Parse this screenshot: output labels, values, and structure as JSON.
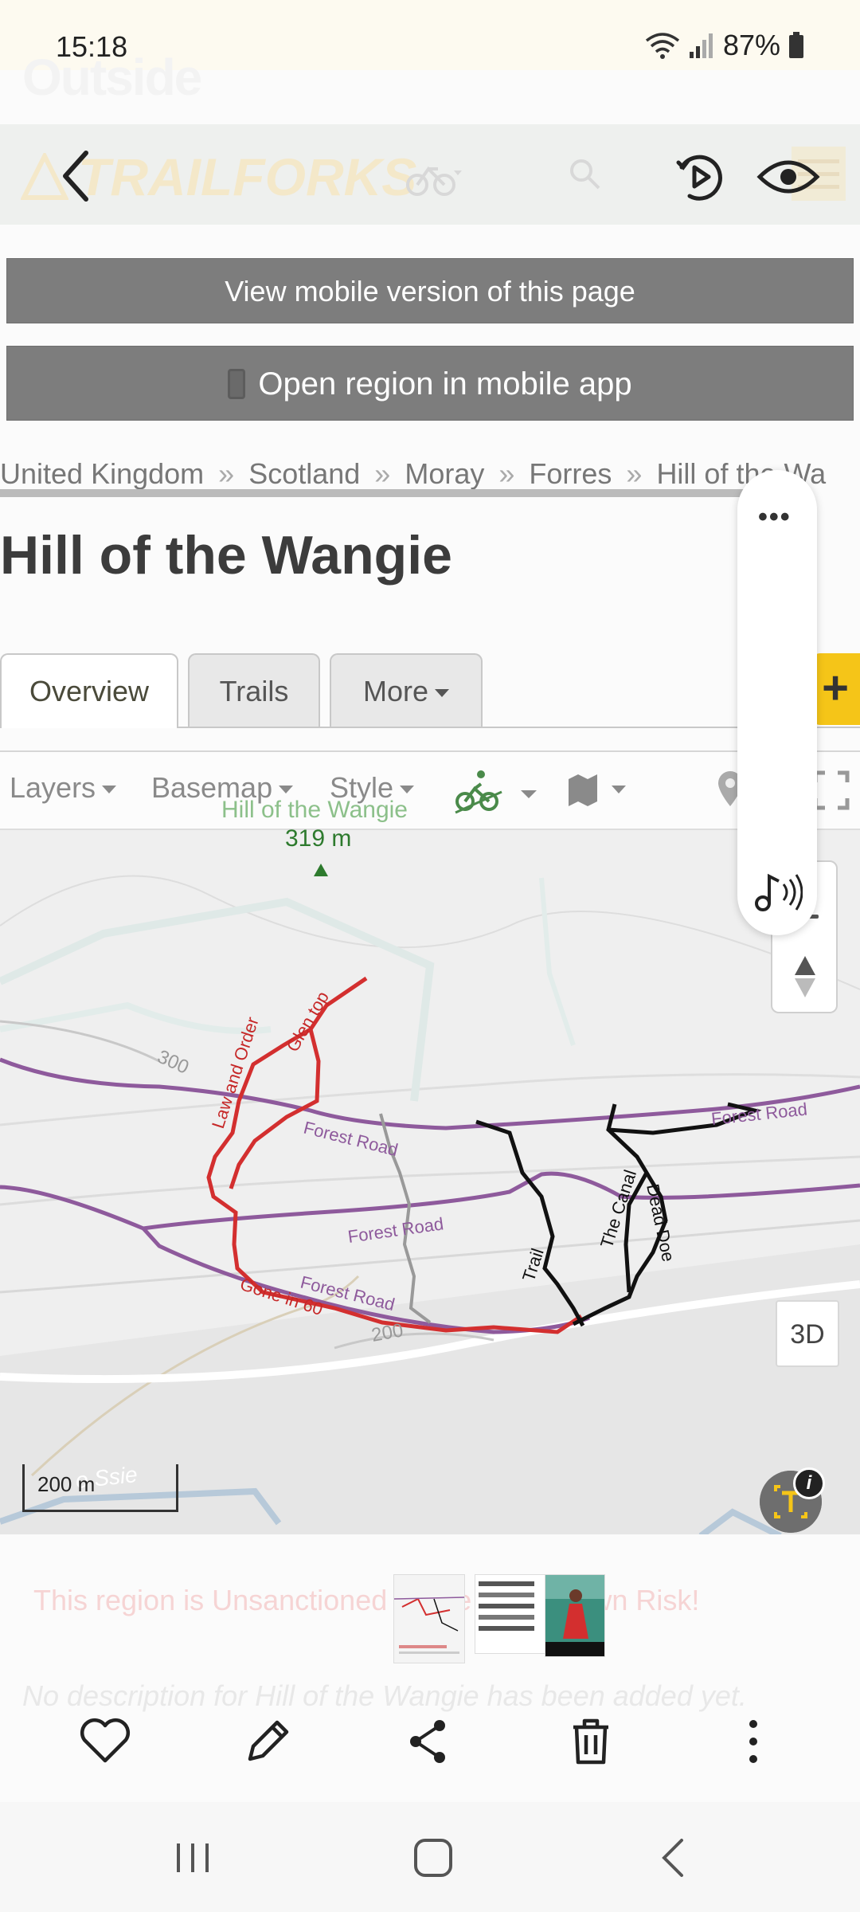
{
  "status_bar": {
    "time": "15:18",
    "battery": "87%"
  },
  "header": {
    "site_logo": "Outside",
    "brand": "TRAILFORKS"
  },
  "buttons": {
    "mobile_version": "View mobile version of this page",
    "open_app": "Open region in mobile app"
  },
  "breadcrumbs": [
    "United Kingdom",
    "Scotland",
    "Moray",
    "Forres",
    "Hill of the Wa"
  ],
  "breadcrumb_separator": "»",
  "page_title": "Hill of the Wangie",
  "tabs": {
    "overview": "Overview",
    "trails": "Trails",
    "more": "More",
    "add": "+"
  },
  "map_toolbar": {
    "layers": "Layers",
    "basemap": "Basemap",
    "style": "Style"
  },
  "map": {
    "peak_name": "Hill of the Wangie",
    "peak_elevation": "319 m",
    "contours": [
      "300",
      "200"
    ],
    "labels": {
      "law_and_order": "Law and Order",
      "glen_top": "Glen top",
      "forest_road": "Forest Road",
      "gone_in_60": "Gone in 60",
      "trail": "Trail",
      "the_canal": "The Canal",
      "dead_doe": "Dead Doe",
      "faded_place": "o Ssie"
    },
    "btn_3d": "3D",
    "scale": "200 m"
  },
  "page_text": {
    "warning": "This region is Unsanctioned - Ride at your own Risk!",
    "description": "No description for Hill of the Wangie has been added yet."
  },
  "colors": {
    "primary_trail": "#d32f2f",
    "secondary_trail": "#111111",
    "forest_road": "#8e5a9c",
    "gray_trail": "#999999",
    "accent_yellow": "#f5c518",
    "button_gray": "#7d7d7d"
  },
  "icons": {
    "back": "chevron-left-icon",
    "screen_record": "play-circle-icon",
    "visibility": "eye-icon",
    "favorite": "heart-icon",
    "edit": "pencil-icon",
    "share": "share-icon",
    "delete": "trash-icon",
    "more": "more-vertical-icon"
  }
}
